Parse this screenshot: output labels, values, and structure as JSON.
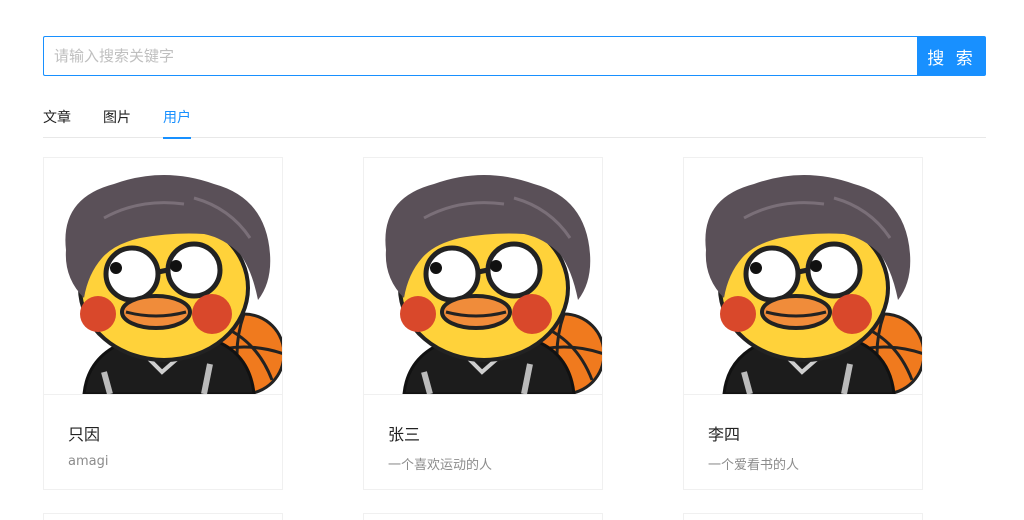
{
  "search": {
    "placeholder": "请输入搜索关键字",
    "value": "",
    "button_label": "搜 索"
  },
  "tabs": [
    {
      "label": "文章",
      "active": false
    },
    {
      "label": "图片",
      "active": false
    },
    {
      "label": "用户",
      "active": true
    }
  ],
  "colors": {
    "accent": "#1890ff",
    "hair": "#5a5058",
    "face": "#ffd23a",
    "cheek": "#d9482b",
    "beak": "#f08c3a",
    "ball": "#f07a1e"
  },
  "users": [
    {
      "name": "只因",
      "description": "amagi",
      "avatar_icon": "duck-avatar-icon"
    },
    {
      "name": "张三",
      "description": "一个喜欢运动的人",
      "avatar_icon": "duck-avatar-icon"
    },
    {
      "name": "李四",
      "description": "一个爱看书的人",
      "avatar_icon": "duck-avatar-icon"
    }
  ]
}
